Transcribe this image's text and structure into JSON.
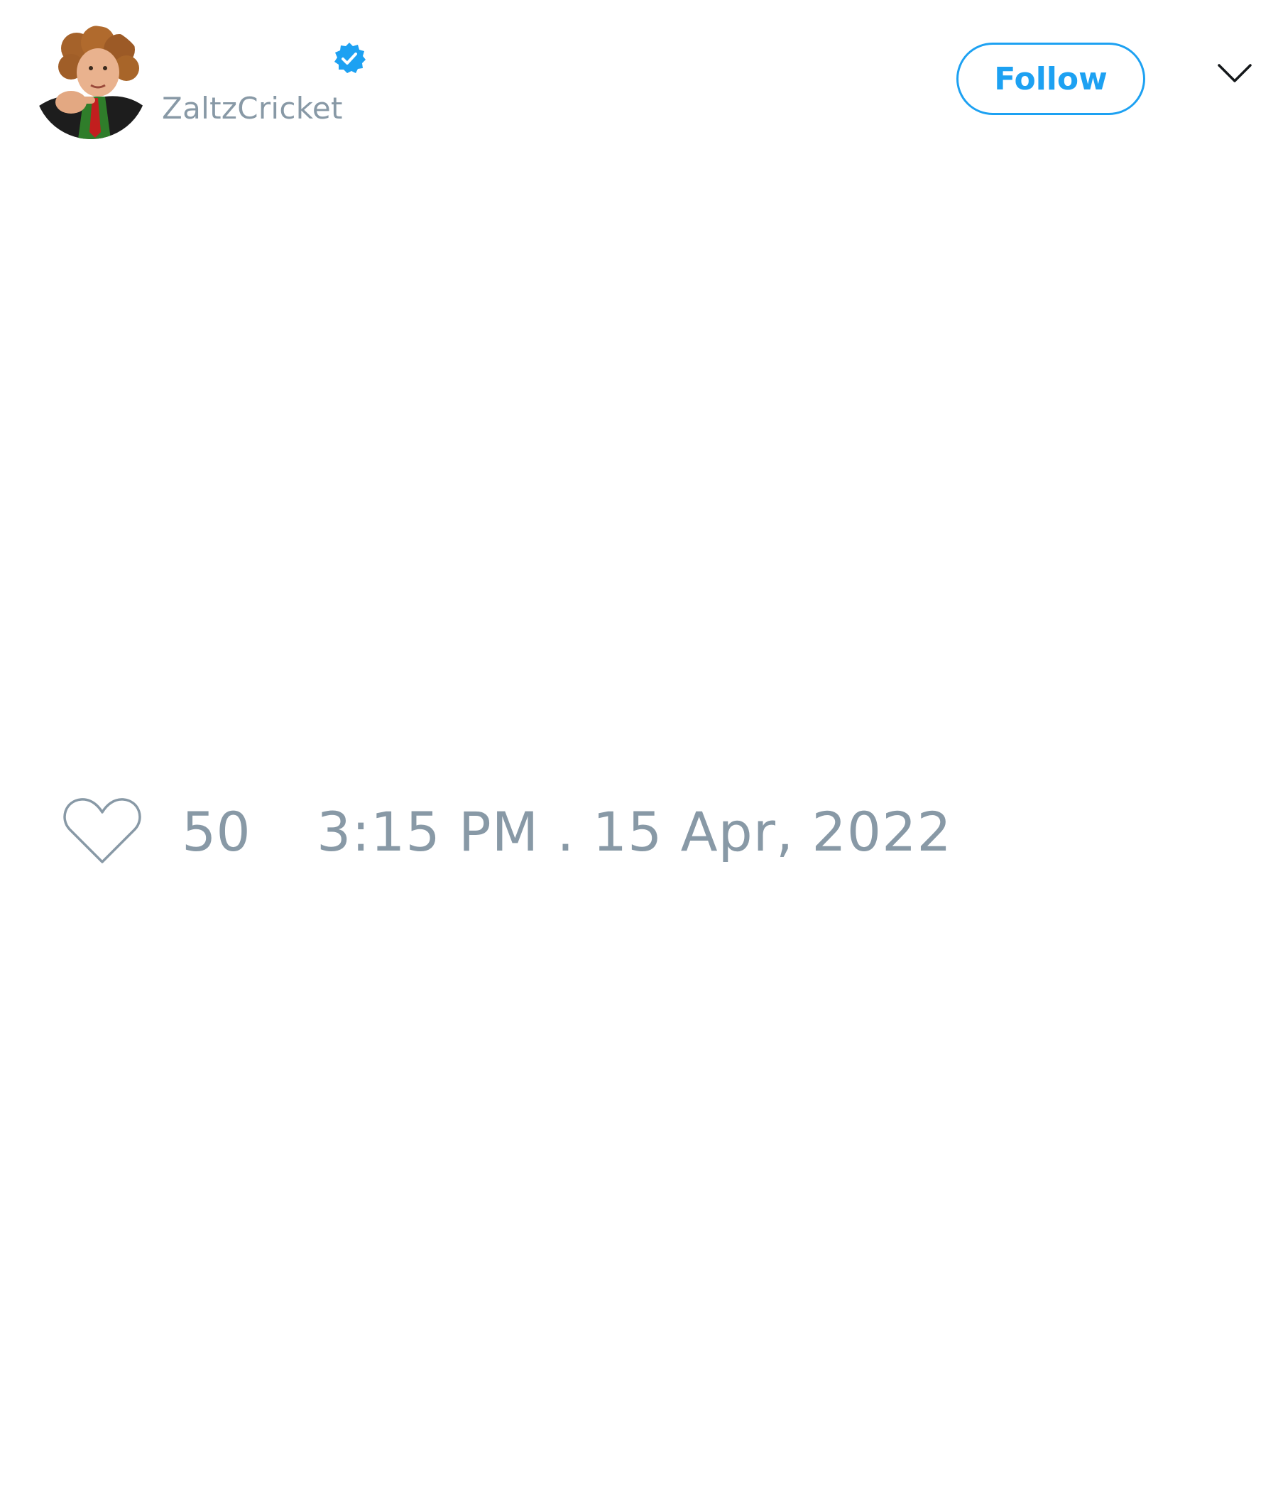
{
  "author": {
    "display_name": "",
    "handle": "ZaltzCricket",
    "verified": true,
    "avatar_description": "profile photo"
  },
  "actions": {
    "follow_label": "Follow",
    "menu_icon": "chevron-down-icon"
  },
  "footer": {
    "like_icon": "heart-icon",
    "like_count": "50",
    "timestamp": "3:15 PM . 15 Apr, 2022"
  },
  "colors": {
    "accent": "#1da1f2",
    "muted_text": "#8899a6",
    "background": "#ffffff"
  }
}
